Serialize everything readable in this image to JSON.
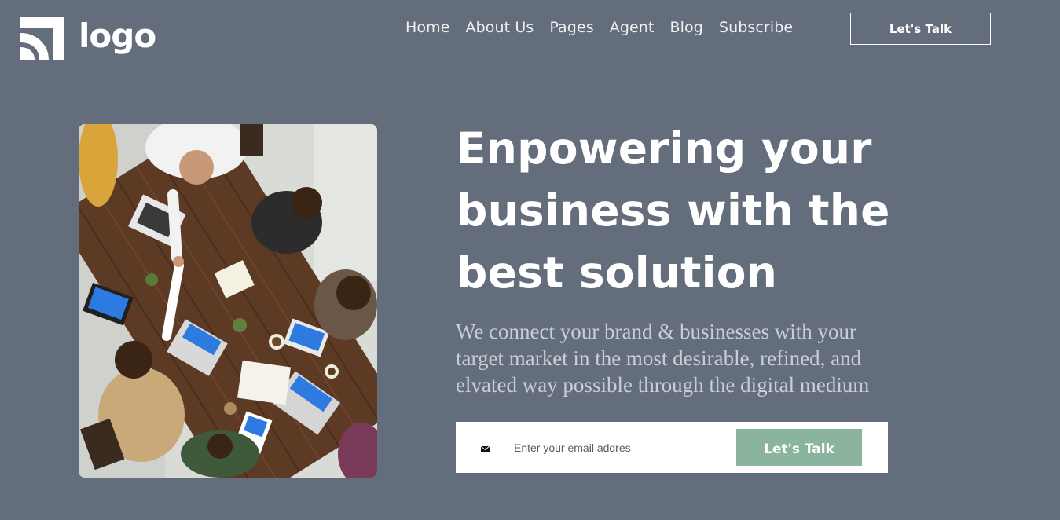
{
  "header": {
    "logo_text": "logo",
    "nav": [
      {
        "label": "Home"
      },
      {
        "label": "About Us"
      },
      {
        "label": "Pages"
      },
      {
        "label": "Agent"
      },
      {
        "label": "Blog"
      },
      {
        "label": "Subscribe"
      }
    ],
    "cta_label": "Let's Talk"
  },
  "hero": {
    "title": "Enpowering your business with the best solution",
    "subtitle": "We connect your brand & businesses with your target market in the most desirable, refined, and elvated way possible through the digital medium",
    "email_placeholder": "Enter your email addres",
    "email_icon": "mail-icon",
    "submit_label": "Let's Talk",
    "image_alt_icon": "team-meeting-photo"
  },
  "colors": {
    "background": "#636d7b",
    "accent_button": "#8bb49f",
    "text": "#ffffff",
    "subtitle_text": "#c9ced6"
  }
}
